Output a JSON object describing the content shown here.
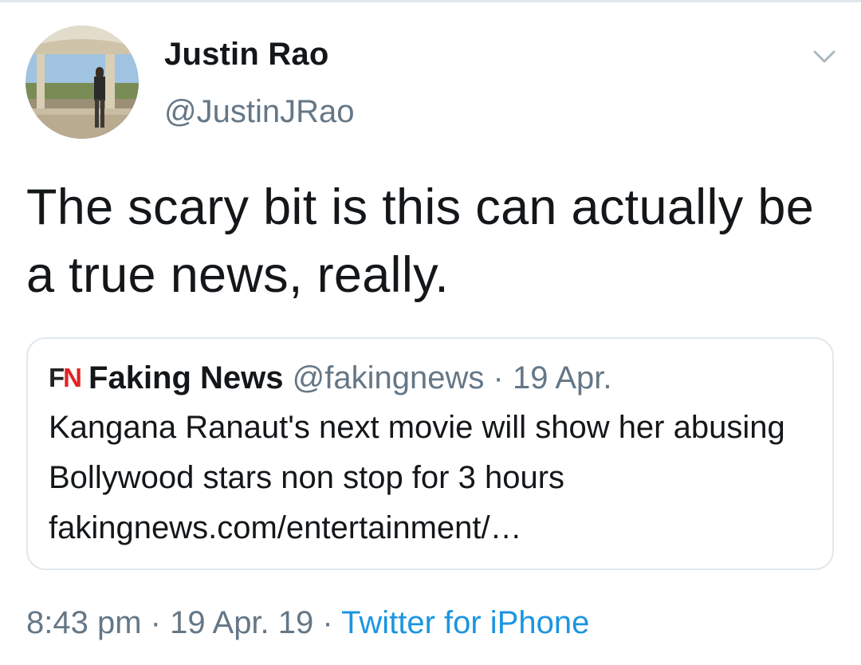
{
  "author": {
    "display_name": "Justin Rao",
    "handle": "@JustinJRao"
  },
  "tweet": {
    "text": "The scary bit is this can actually be a true news, really."
  },
  "quoted_tweet": {
    "logo_f": "F",
    "logo_n": "N",
    "name": "Faking News",
    "handle": "@fakingnews",
    "separator": "·",
    "date": "19 Apr.",
    "text": "Kangana Ranaut's next movie will show her abusing Bollywood stars non stop for 3 hours fakingnews.com/entertainment/…"
  },
  "meta": {
    "time": "8:43 pm",
    "separator": "·",
    "date": "19 Apr. 19",
    "source": "Twitter for iPhone"
  },
  "icons": {
    "options": "chevron-down-icon",
    "avatar": "profile-photo"
  },
  "colors": {
    "text_primary": "#14171a",
    "text_secondary": "#657786",
    "link": "#1b95e0",
    "border": "#e1e8ed",
    "logo_red": "#e02424"
  }
}
